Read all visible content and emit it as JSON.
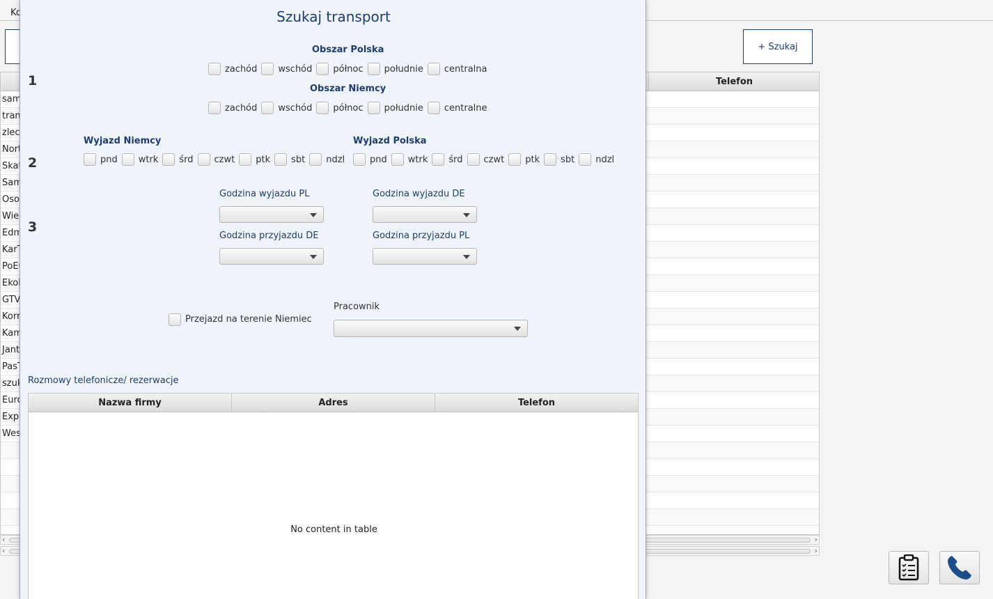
{
  "background": {
    "menu_item": "Ko",
    "search_button": "+ Szukaj",
    "table_header_telefon": "Telefon",
    "rows": [
      "sam",
      "tran",
      "zlec",
      "Nort",
      "Skat",
      "Sam",
      "Oso",
      "Wiel",
      "Edm",
      "KarT",
      "PoEu",
      "Ekol",
      "GTV",
      "Korr",
      "Kam",
      "Jant",
      "PasT",
      "szuk",
      "Euro",
      "Expr",
      "Wes",
      "",
      "",
      "",
      "",
      "",
      ""
    ]
  },
  "dialog": {
    "title": "Szukaj transport",
    "step1": "1",
    "step2": "2",
    "step3": "3",
    "obszar_polska": {
      "title": "Obszar Polska",
      "options": [
        "zachód",
        "wschód",
        "północ",
        "południe",
        "centralna"
      ]
    },
    "obszar_niemcy": {
      "title": "Obszar Niemcy",
      "options": [
        "zachód",
        "wschód",
        "północ",
        "południe",
        "centralne"
      ]
    },
    "wyjazd_niemcy": {
      "title": "Wyjazd Niemcy",
      "days": [
        "pnd",
        "wtrk",
        "śrd",
        "czwt",
        "ptk",
        "sbt",
        "ndzl"
      ]
    },
    "wyjazd_polska": {
      "title": "Wyjazd Polska",
      "days": [
        "pnd",
        "wtrk",
        "śrd",
        "czwt",
        "ptk",
        "sbt",
        "ndzl"
      ]
    },
    "godzina_wyjazdu_pl": "Godzina wyjazdu PL",
    "godzina_wyjazdu_de": "Godzina wyjazdu DE",
    "godzina_przyjazdu_de": "Godzina przyjazdu DE",
    "godzina_przyjazdu_pl": "Godzina przyjazdu PL",
    "przejazd_label": "Przejazd na terenie Niemiec",
    "pracownik_label": "Pracownik",
    "calls_label": "Rozmowy telefonicze/ rezerwacje",
    "calls_table": {
      "columns": [
        "Nazwa firmy",
        "Adres",
        "Telefon"
      ],
      "empty_text": "No content in table"
    }
  },
  "colors": {
    "accent": "#1c3d6e",
    "dialog_bg": "#eff3fa",
    "phone_icon": "#1c4f8a"
  }
}
